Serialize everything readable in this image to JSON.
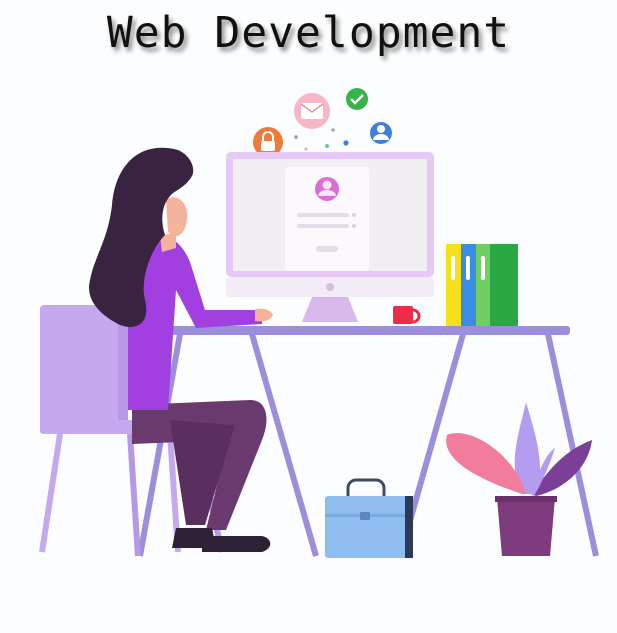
{
  "title": "Web Development",
  "colors": {
    "background": "#fbfdfe",
    "purple_shirt": "#a23fe0",
    "hair": "#3a2340",
    "pants": "#6a3a6e",
    "chair": "#c5a9ef",
    "desk": "#9b8fdc",
    "monitor_frame": "#e7c9f6",
    "mug": "#ef2b4a",
    "binder_yellow": "#f4e11a",
    "binder_blue": "#3a8de2",
    "binder_lightgreen": "#6fcf63",
    "binder_green": "#2aa843",
    "leaf_pink": "#f27c9b",
    "leaf_purple": "#7a3f97",
    "pot": "#7e3b7e",
    "bag": "#8fbcf1"
  },
  "icons": [
    "lock-icon",
    "mail-icon",
    "check-icon",
    "user-icon",
    "profile-avatar-icon"
  ]
}
